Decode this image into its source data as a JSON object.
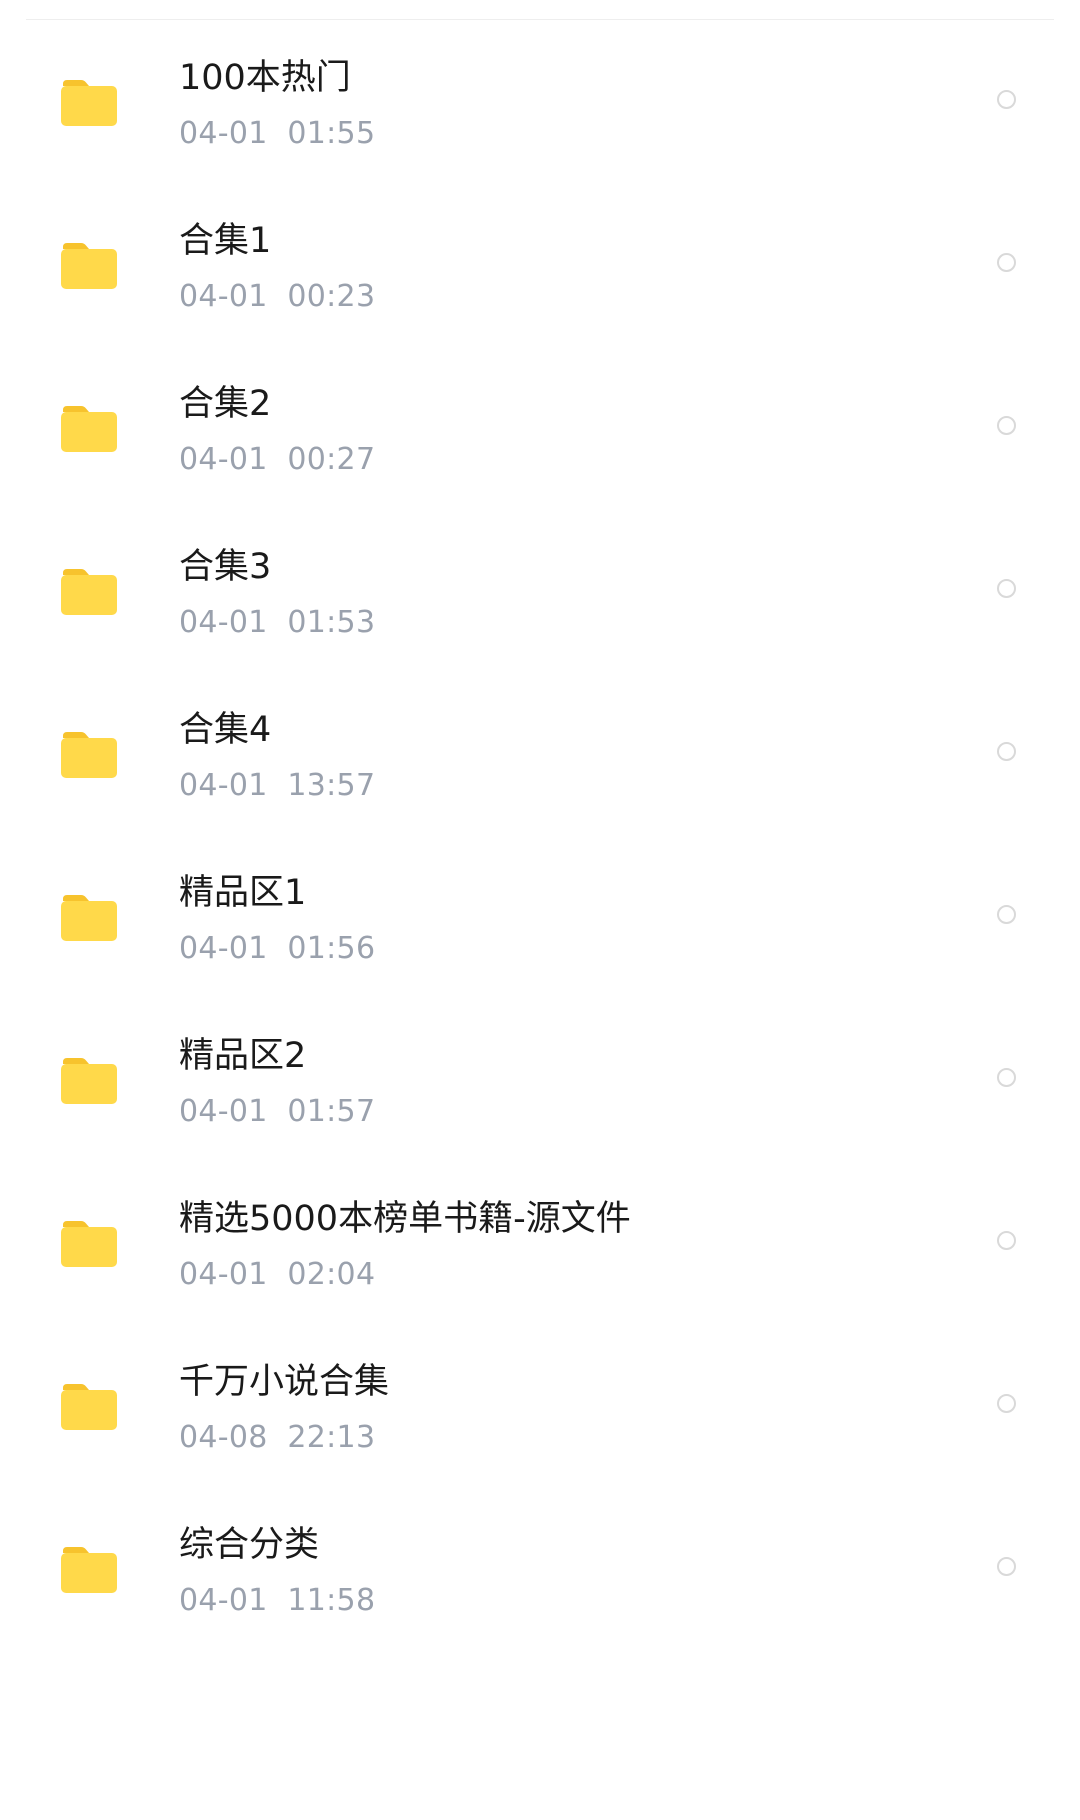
{
  "colors": {
    "folder_body": "#ffd94a",
    "folder_tab": "#f7c32d",
    "name_text": "#1a1a1a",
    "time_text": "#9aa1ad",
    "radio_border": "#d9d9d9"
  },
  "items": [
    {
      "name": "100本热门",
      "date": "04-01",
      "time": "01:55",
      "icon": "folder-icon"
    },
    {
      "name": "合集1",
      "date": "04-01",
      "time": "00:23",
      "icon": "folder-icon"
    },
    {
      "name": "合集2",
      "date": "04-01",
      "time": "00:27",
      "icon": "folder-icon"
    },
    {
      "name": "合集3",
      "date": "04-01",
      "time": "01:53",
      "icon": "folder-icon"
    },
    {
      "name": "合集4",
      "date": "04-01",
      "time": "13:57",
      "icon": "folder-icon"
    },
    {
      "name": "精品区1",
      "date": "04-01",
      "time": "01:56",
      "icon": "folder-icon"
    },
    {
      "name": "精品区2",
      "date": "04-01",
      "time": "01:57",
      "icon": "folder-icon"
    },
    {
      "name": "精选5000本榜单书籍-源文件",
      "date": "04-01",
      "time": "02:04",
      "icon": "folder-icon"
    },
    {
      "name": "千万小说合集",
      "date": "04-08",
      "time": "22:13",
      "icon": "folder-icon"
    },
    {
      "name": "综合分类",
      "date": "04-01",
      "time": "11:58",
      "icon": "folder-icon"
    }
  ]
}
